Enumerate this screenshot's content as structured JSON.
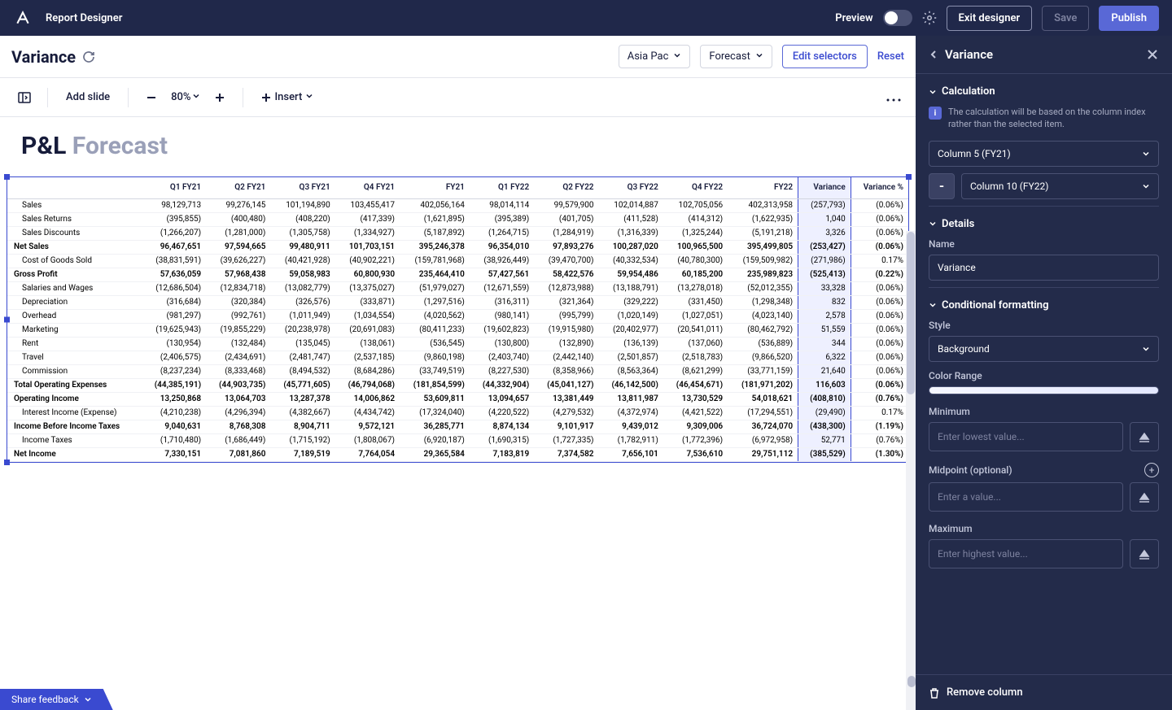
{
  "topbar": {
    "app_title": "Report Designer",
    "preview": "Preview",
    "exit": "Exit designer",
    "save": "Save",
    "publish": "Publish"
  },
  "subheader": {
    "title": "Variance",
    "selector1": "Asia Pac",
    "selector2": "Forecast",
    "edit_selectors": "Edit selectors",
    "reset": "Reset"
  },
  "toolbar": {
    "add_slide": "Add slide",
    "zoom": "80%",
    "insert": "Insert"
  },
  "report": {
    "title_dark": "P&L",
    "title_light": "Forecast",
    "headers": [
      "",
      "Q1 FY21",
      "Q2 FY21",
      "Q3 FY21",
      "Q4 FY21",
      "FY21",
      "Q1 FY22",
      "Q2 FY22",
      "Q3 FY22",
      "Q4 FY22",
      "FY22",
      "Variance",
      "Variance %"
    ],
    "rows": [
      {
        "label": "Sales",
        "indent": 1,
        "bold": false,
        "cells": [
          "98,129,713",
          "99,276,145",
          "101,194,890",
          "103,455,417",
          "402,056,164",
          "98,014,114",
          "99,579,900",
          "102,014,887",
          "102,705,056",
          "402,313,958",
          "(257,793)",
          "(0.06%)"
        ]
      },
      {
        "label": "Sales Returns",
        "indent": 1,
        "bold": false,
        "cells": [
          "(395,855)",
          "(400,480)",
          "(408,220)",
          "(417,339)",
          "(1,621,895)",
          "(395,389)",
          "(401,705)",
          "(411,528)",
          "(414,312)",
          "(1,622,935)",
          "1,040",
          "(0.06%)"
        ]
      },
      {
        "label": "Sales Discounts",
        "indent": 1,
        "bold": false,
        "cells": [
          "(1,266,207)",
          "(1,281,000)",
          "(1,305,758)",
          "(1,334,927)",
          "(5,187,892)",
          "(1,264,715)",
          "(1,284,919)",
          "(1,316,339)",
          "(1,325,244)",
          "(5,191,218)",
          "3,326",
          "(0.06%)"
        ]
      },
      {
        "label": "Net Sales",
        "indent": 0,
        "bold": true,
        "cells": [
          "96,467,651",
          "97,594,665",
          "99,480,911",
          "101,703,151",
          "395,246,378",
          "96,354,010",
          "97,893,276",
          "100,287,020",
          "100,965,500",
          "395,499,805",
          "(253,427)",
          "(0.06%)"
        ]
      },
      {
        "label": "Cost of Goods Sold",
        "indent": 1,
        "bold": false,
        "cells": [
          "(38,831,591)",
          "(39,626,227)",
          "(40,421,928)",
          "(40,902,221)",
          "(159,781,968)",
          "(38,926,449)",
          "(39,470,700)",
          "(40,332,534)",
          "(40,780,300)",
          "(159,509,982)",
          "(271,986)",
          "0.17%"
        ]
      },
      {
        "label": "Gross Profit",
        "indent": 0,
        "bold": true,
        "cells": [
          "57,636,059",
          "57,968,438",
          "59,058,983",
          "60,800,930",
          "235,464,410",
          "57,427,561",
          "58,422,576",
          "59,954,486",
          "60,185,200",
          "235,989,823",
          "(525,413)",
          "(0.22%)"
        ]
      },
      {
        "label": "Salaries and Wages",
        "indent": 1,
        "bold": false,
        "cells": [
          "(12,686,504)",
          "(12,834,718)",
          "(13,082,779)",
          "(13,375,027)",
          "(51,979,027)",
          "(12,671,559)",
          "(12,873,988)",
          "(13,188,791)",
          "(13,278,018)",
          "(52,012,355)",
          "33,328",
          "(0.06%)"
        ]
      },
      {
        "label": "Depreciation",
        "indent": 1,
        "bold": false,
        "cells": [
          "(316,684)",
          "(320,384)",
          "(326,576)",
          "(333,871)",
          "(1,297,516)",
          "(316,311)",
          "(321,364)",
          "(329,222)",
          "(331,450)",
          "(1,298,348)",
          "832",
          "(0.06%)"
        ]
      },
      {
        "label": "Overhead",
        "indent": 1,
        "bold": false,
        "cells": [
          "(981,297)",
          "(992,761)",
          "(1,011,949)",
          "(1,034,554)",
          "(4,020,562)",
          "(980,141)",
          "(995,799)",
          "(1,020,149)",
          "(1,027,051)",
          "(4,023,140)",
          "2,578",
          "(0.06%)"
        ]
      },
      {
        "label": "Marketing",
        "indent": 1,
        "bold": false,
        "cells": [
          "(19,625,943)",
          "(19,855,229)",
          "(20,238,978)",
          "(20,691,083)",
          "(80,411,233)",
          "(19,602,823)",
          "(19,915,980)",
          "(20,402,977)",
          "(20,541,011)",
          "(80,462,792)",
          "51,559",
          "(0.06%)"
        ]
      },
      {
        "label": "Rent",
        "indent": 1,
        "bold": false,
        "cells": [
          "(130,954)",
          "(132,484)",
          "(135,045)",
          "(138,061)",
          "(536,545)",
          "(130,800)",
          "(132,890)",
          "(136,139)",
          "(137,060)",
          "(536,889)",
          "344",
          "(0.06%)"
        ]
      },
      {
        "label": "Travel",
        "indent": 1,
        "bold": false,
        "cells": [
          "(2,406,575)",
          "(2,434,691)",
          "(2,481,747)",
          "(2,537,185)",
          "(9,860,198)",
          "(2,403,740)",
          "(2,442,140)",
          "(2,501,857)",
          "(2,518,783)",
          "(9,866,520)",
          "6,322",
          "(0.06%)"
        ]
      },
      {
        "label": "Commission",
        "indent": 1,
        "bold": false,
        "cells": [
          "(8,237,234)",
          "(8,333,468)",
          "(8,494,532)",
          "(8,684,286)",
          "(33,749,519)",
          "(8,227,530)",
          "(8,358,966)",
          "(8,563,364)",
          "(8,621,299)",
          "(33,771,159)",
          "21,640",
          "(0.06%)"
        ]
      },
      {
        "label": "Total Operating Expenses",
        "indent": 0,
        "bold": true,
        "cells": [
          "(44,385,191)",
          "(44,903,735)",
          "(45,771,605)",
          "(46,794,068)",
          "(181,854,599)",
          "(44,332,904)",
          "(45,041,127)",
          "(46,142,500)",
          "(46,454,671)",
          "(181,971,202)",
          "116,603",
          "(0.06%)"
        ]
      },
      {
        "label": "Operating Income",
        "indent": 0,
        "bold": true,
        "cells": [
          "13,250,868",
          "13,064,703",
          "13,287,378",
          "14,006,862",
          "53,609,811",
          "13,094,657",
          "13,381,449",
          "13,811,987",
          "13,730,529",
          "54,018,621",
          "(408,810)",
          "(0.76%)"
        ]
      },
      {
        "label": "Interest Income (Expense)",
        "indent": 1,
        "bold": false,
        "cells": [
          "(4,210,238)",
          "(4,296,394)",
          "(4,382,667)",
          "(4,434,742)",
          "(17,324,040)",
          "(4,220,522)",
          "(4,279,532)",
          "(4,372,974)",
          "(4,421,522)",
          "(17,294,551)",
          "(29,490)",
          "0.17%"
        ]
      },
      {
        "label": "Income Before Income Taxes",
        "indent": 0,
        "bold": true,
        "cells": [
          "9,040,631",
          "8,768,308",
          "8,904,711",
          "9,572,121",
          "36,285,771",
          "8,874,134",
          "9,101,917",
          "9,439,012",
          "9,309,006",
          "36,724,070",
          "(438,300)",
          "(1.19%)"
        ]
      },
      {
        "label": "Income Taxes",
        "indent": 1,
        "bold": false,
        "cells": [
          "(1,710,480)",
          "(1,686,449)",
          "(1,715,192)",
          "(1,808,067)",
          "(6,920,187)",
          "(1,690,315)",
          "(1,727,335)",
          "(1,782,911)",
          "(1,772,396)",
          "(6,972,958)",
          "52,771",
          "(0.76%)"
        ]
      },
      {
        "label": "Net Income",
        "indent": 0,
        "bold": true,
        "cells": [
          "7,330,151",
          "7,081,860",
          "7,189,519",
          "7,764,054",
          "29,365,584",
          "7,183,819",
          "7,374,582",
          "7,656,101",
          "7,536,610",
          "29,751,112",
          "(385,529)",
          "(1.30%)"
        ]
      }
    ]
  },
  "panel": {
    "title": "Variance",
    "calc_section": "Calculation",
    "calc_info": "The calculation will be based on the column index rather than the selected item.",
    "col5": "Column 5 (FY21)",
    "op": "-",
    "col10": "Column 10 (FY22)",
    "details_section": "Details",
    "name_label": "Name",
    "name_value": "Variance",
    "cf_section": "Conditional formatting",
    "style_label": "Style",
    "style_value": "Background",
    "color_range_label": "Color Range",
    "min_label": "Minimum",
    "min_placeholder": "Enter lowest value...",
    "mid_label": "Midpoint (optional)",
    "mid_placeholder": "Enter a value...",
    "max_label": "Maximum",
    "max_placeholder": "Enter highest value...",
    "remove": "Remove column"
  },
  "feedback": "Share feedback"
}
